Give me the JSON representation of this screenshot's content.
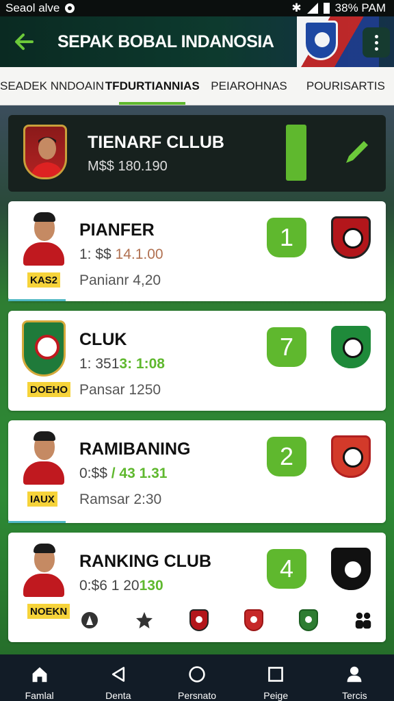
{
  "status_bar": {
    "left_text": "Seaol alve",
    "right_text": "38% PAM"
  },
  "app_bar": {
    "title": "SEPAK BOBAL INDANOSIA"
  },
  "tabs": [
    {
      "label": "SEADEK NNDOAIN",
      "active": false
    },
    {
      "label": "TFDURTIANNIAS",
      "active": true
    },
    {
      "label": "PEIAROHNAS",
      "active": false
    },
    {
      "label": "POURISARTIS",
      "active": false
    }
  ],
  "featured": {
    "title": "TIENARF CLLUB",
    "subtitle": "M$$ 180.190"
  },
  "cards": [
    {
      "name": "PIANFER",
      "value_prefix": "1: $$ ",
      "value_highlight": "14.1.00",
      "tag": "KAS2",
      "sub": "Panianr 4,20",
      "rank": "1"
    },
    {
      "name": "CLUK",
      "value_prefix": "1: 351",
      "value_highlight": "3: 1:08",
      "tag": "DOEHO",
      "sub": "Pansar 1250",
      "rank": "7"
    },
    {
      "name": "RAMIBANING",
      "value_prefix": "0:$$ ",
      "value_highlight": "/ 43 1.31",
      "tag": "IAUX",
      "sub": "Ramsar 2:30",
      "rank": "2"
    },
    {
      "name": "RANKING CLUB",
      "value_prefix": "0:$6 1 20",
      "value_highlight": "130",
      "tag": "NOEKN",
      "rank": "4"
    }
  ],
  "bottom_nav": [
    {
      "label": "Famlal",
      "icon": "home-icon"
    },
    {
      "label": "Denta",
      "icon": "back-triangle-icon"
    },
    {
      "label": "Persnato",
      "icon": "circle-icon"
    },
    {
      "label": "Peige",
      "icon": "square-icon"
    },
    {
      "label": "Tercis",
      "icon": "profile-icon"
    }
  ],
  "colors": {
    "accent_green": "#5fb82e",
    "tag_yellow": "#f6d33a",
    "app_bar_dark": "#0d3a2e",
    "nav_dark": "#121c27"
  }
}
